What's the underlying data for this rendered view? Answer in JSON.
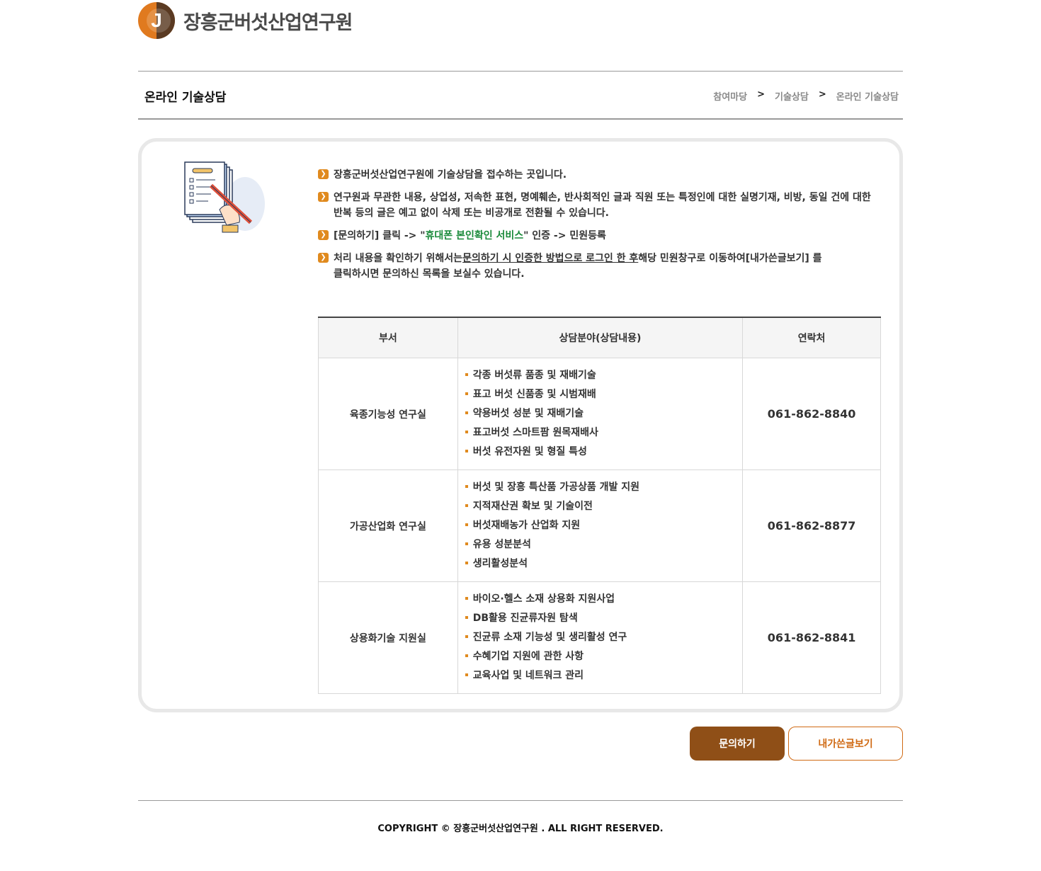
{
  "header": {
    "logo_letter": "J",
    "logo_text": "장흥군버섯산업연구원"
  },
  "title_bar": {
    "title": "온라인 기술상담",
    "breadcrumb": [
      "참여마당",
      "기술상담",
      "온라인 기술상담"
    ],
    "separator": ">"
  },
  "notices": {
    "n1": "장흥군버섯산업연구원에 기술상담을 접수하는 곳입니다.",
    "n2_line1": "연구원과 무관한 내용, 상업성, 저속한 표현, 명예훼손, 반사회적인 글과 직원 또는 특정인에 대한 실명기재, 비방, 동일 건에 대한",
    "n2_line2": "반복 등의 글은 예고 없이 삭제 또는 비공개로 전환될 수 있습니다.",
    "n3_a": "[문의하기] 클릭 -> \"",
    "n3_green": "휴대폰 본인확인 서비스",
    "n3_b": "\" 인증 -> 민원등록",
    "n4_a": "처리 내용을 확인하기 위해서는",
    "n4_underline": "문의하기 시 인증한 방법으로 로그인 한 후",
    "n4_b": "해당 민원창구로 이동하여[내가쓴글보기] 를",
    "n4_line2": "클릭하시면 문의하신 목록을 보실수 있습니다."
  },
  "table": {
    "headers": [
      "부서",
      "상담분야(상담내용)",
      "연락처"
    ],
    "rows": [
      {
        "dept": "육종기능성 연구실",
        "items": [
          "각종 버섯류 품종 및 재배기술",
          "표고 버섯 신품종 및 시범재배",
          "약용버섯 성분 및 재배기술",
          "표고버섯 스마트팜 원목재배사",
          "버섯 유전자원 및 형질 특성"
        ],
        "phone": "061-862-8840"
      },
      {
        "dept": "가공산업화 연구실",
        "items": [
          "버섯 및 장흥 특산품 가공상품 개발 지원",
          "지적재산권 확보 및 기술이전",
          "버섯재배농가 산업화 지원",
          "유용 성분분석",
          "생리활성분석"
        ],
        "phone": "061-862-8877"
      },
      {
        "dept": "상용화기술 지원실",
        "items": [
          "바이오·헬스 소재 상용화 지원사업",
          "DB활용 진균류자원 탐색",
          "진균류 소재 기능성 및 생리활성 연구",
          "수혜기업 지원에 관한 사항",
          "교육사업 및 네트워크 관리"
        ],
        "phone": "061-862-8841"
      }
    ]
  },
  "buttons": {
    "ask": "문의하기",
    "my_posts": "내가쓴글보기"
  },
  "footer": {
    "copyright": "COPYRIGHT © 장흥군버섯산업연구원 . ALL RIGHT RESERVED."
  },
  "colors": {
    "accent": "#e08a1e",
    "brand_brown": "#8f4f17",
    "green": "#1a8a3a"
  }
}
